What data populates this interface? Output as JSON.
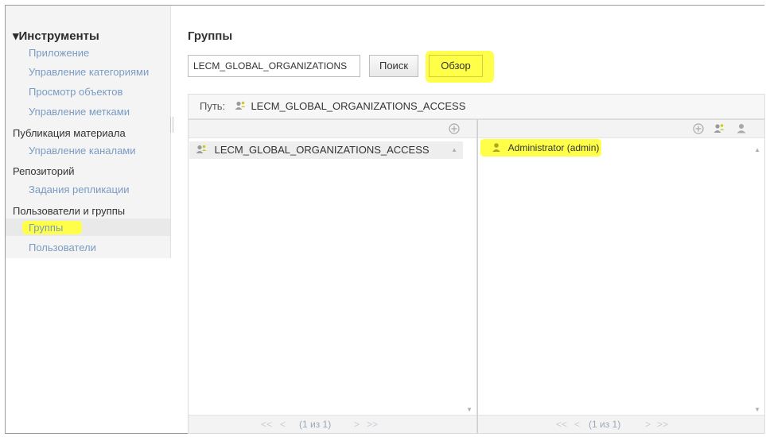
{
  "sidebar": {
    "root_label": "▾Инструменты",
    "items": [
      {
        "label": "Приложение",
        "type": "link"
      },
      {
        "label": "Управление категориями",
        "type": "link"
      },
      {
        "label": "Просмотр объектов",
        "type": "link"
      },
      {
        "label": "Управление метками",
        "type": "link"
      },
      {
        "label": "Публикация материала",
        "type": "category"
      },
      {
        "label": "Управление каналами",
        "type": "link"
      },
      {
        "label": "Репозиторий",
        "type": "category"
      },
      {
        "label": "Задания репликации",
        "type": "link"
      },
      {
        "label": "Пользователи и группы",
        "type": "category"
      },
      {
        "label": "Группы",
        "type": "link",
        "active": true
      },
      {
        "label": "Пользователи",
        "type": "link"
      }
    ]
  },
  "main": {
    "title": "Группы",
    "search_value": "LECM_GLOBAL_ORGANIZATIONS",
    "search_button": "Поиск",
    "browse_button": "Обзор",
    "path_label": "Путь:",
    "path_value": "LECM_GLOBAL_ORGANIZATIONS_ACCESS"
  },
  "left_panel": {
    "rows": [
      "LECM_GLOBAL_ORGANIZATIONS_ACCESS"
    ],
    "pager": {
      "first": "<<",
      "prev": "<",
      "info": "(1 из 1)",
      "next": ">",
      "last": ">>"
    }
  },
  "right_panel": {
    "rows": [
      "Administrator (admin)"
    ],
    "pager": {
      "first": "<<",
      "prev": "<",
      "info": "(1 из 1)",
      "next": ">",
      "last": ">>"
    }
  },
  "icons": {
    "add": "plus-circle-icon",
    "add_group": "group-add-icon",
    "add_user": "user-add-icon",
    "group": "group-icon",
    "user": "user-icon"
  },
  "colors": {
    "highlight": "#ffff4a",
    "link": "#7a9bc2"
  }
}
